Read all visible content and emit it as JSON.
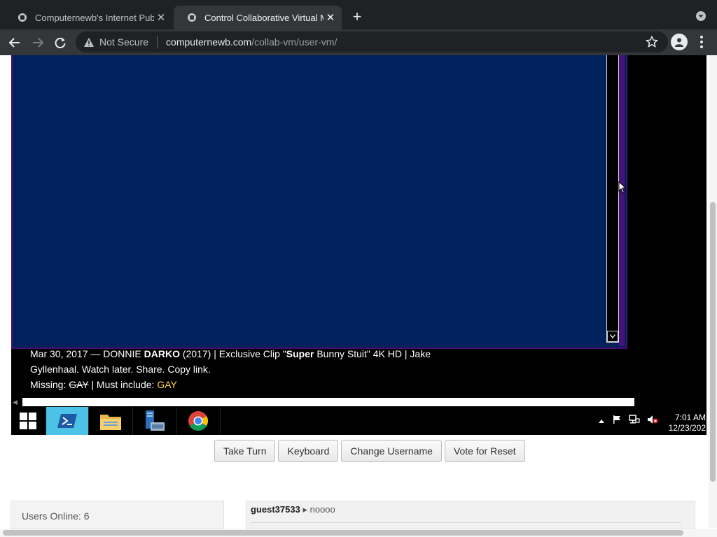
{
  "browser": {
    "tabs": [
      {
        "title": "Computernewb's Internet Pub",
        "active": false
      },
      {
        "title": "Control Collaborative Virtual M",
        "active": true
      }
    ],
    "security_label": "Not Secure",
    "url_host": "computernewb.com",
    "url_path": "/collab-vm/user-vm/"
  },
  "vm": {
    "clip_line1_a": "Mar 30, 2017 — DONNIE ",
    "clip_line1_b": "DARKO",
    "clip_line1_c": " (2017) | Exclusive Clip \"",
    "clip_line1_d": "Super",
    "clip_line1_e": " Bunny Stuit\" 4K HD | Jake",
    "clip_line2": "Gyllenhaal. Watch later. Share. Copy link.",
    "clip_line3_a": "Missing: ",
    "clip_line3_strike": "GAY",
    "clip_line3_b": " | Must include: ",
    "clip_line3_c": "GAY",
    "clock_time": "7:01 AM",
    "clock_date": "12/23/202",
    "taskbar_icons": [
      "windows-start-icon",
      "powershell-icon",
      "file-explorer-icon",
      "server-manager-icon",
      "chrome-icon"
    ]
  },
  "controls": {
    "take_turn": "Take Turn",
    "keyboard": "Keyboard",
    "change_username": "Change Username",
    "vote_reset": "Vote for Reset"
  },
  "users": {
    "label": "Users Online: 6"
  },
  "chat": {
    "messages": [
      {
        "user": "guest37533",
        "text": "noooo"
      }
    ]
  }
}
